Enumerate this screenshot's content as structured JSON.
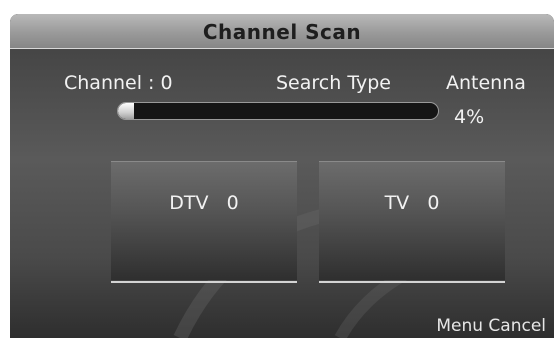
{
  "dialog": {
    "title": "Channel Scan"
  },
  "scan": {
    "channel_label": "Channel : 0",
    "search_type_label": "Search Type",
    "search_type_value": "Antenna",
    "progress_percent_text": "4%",
    "progress_fraction": 0.04
  },
  "counts": {
    "dtv_label": "DTV",
    "dtv_value": "0",
    "tv_label": "TV",
    "tv_value": "0"
  },
  "footer": {
    "hint": "Menu Cancel"
  },
  "colors": {
    "panel_dark": "#4a4a4a",
    "title_bar": "#a3a3a3",
    "text": "#f2f2f2",
    "progress_fill": "#e0e0e0"
  }
}
